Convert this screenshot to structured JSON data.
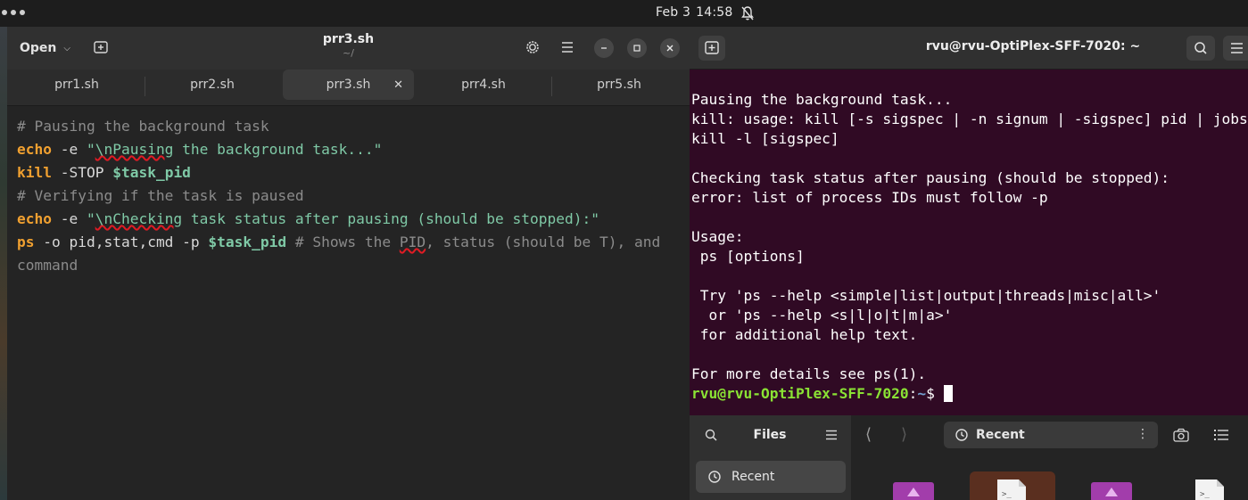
{
  "topbar": {
    "date": "Feb 3",
    "time": "14:58",
    "icons": [
      "activities-dots-icon",
      "bell-muted-icon"
    ]
  },
  "editor": {
    "open_label": "Open",
    "file_name": "prr3.sh",
    "file_path": "~/",
    "tabs": [
      {
        "label": "prr1.sh",
        "active": false
      },
      {
        "label": "prr2.sh",
        "active": false
      },
      {
        "label": "prr3.sh",
        "active": true
      },
      {
        "label": "prr4.sh",
        "active": false
      },
      {
        "label": "prr5.sh",
        "active": false
      }
    ],
    "code": {
      "line1": "# Pausing the background task",
      "line2_kw": "echo",
      "line2_flag": " -e ",
      "line2_q1": "\"",
      "line2_sq": "\\nPausing",
      "line2_rest": " the background task...\"",
      "line3_kw": "kill",
      "line3_flag": " -STOP ",
      "line3_var": "$task_pid",
      "line4": "# Verifying if the task is paused",
      "line5_kw": "echo",
      "line5_flag": " -e ",
      "line5_q1": "\"",
      "line5_sq": "\\nChecking",
      "line5_rest": " task status after pausing (should be stopped):\"",
      "line6_kw": "ps",
      "line6_args": " -o pid,stat,cmd -p ",
      "line6_var": "$task_pid",
      "line6_c1": " # Shows the ",
      "line6_sq": "PID",
      "line6_c2": ", status (should be T), and",
      "line7": "command"
    }
  },
  "terminal": {
    "title": "rvu@rvu-OptiPlex-SFF-7020: ~",
    "lines": {
      "l1": "Pausing the background task...",
      "l2": "kill: usage: kill [-s sigspec | -n signum | -sigspec] pid | jobspec ... or",
      "l3": "kill -l [sigspec]",
      "l4": "Checking task status after pausing (should be stopped):",
      "l5": "error: list of process IDs must follow -p",
      "l6": "Usage:",
      "l7": " ps [options]",
      "l8": " Try 'ps --help <simple|list|output|threads|misc|all>'",
      "l9": "  or 'ps --help <s|l|o|t|m|a>'",
      "l10": " for additional help text.",
      "l11": "For more details see ps(1)."
    },
    "prompt_user": "rvu@rvu-OptiPlex-SFF-7020",
    "prompt_colon": ":",
    "prompt_path": "~",
    "prompt_symbol": "$ "
  },
  "files": {
    "title": "Files",
    "sidebar_recent": "Recent",
    "location": "Recent"
  },
  "colors": {
    "terminal_bg": "#300a24",
    "prompt_green": "#8ae234",
    "prompt_blue": "#729fcf",
    "keyword_orange": "#f0a030",
    "string_teal": "#7fc9a6"
  }
}
